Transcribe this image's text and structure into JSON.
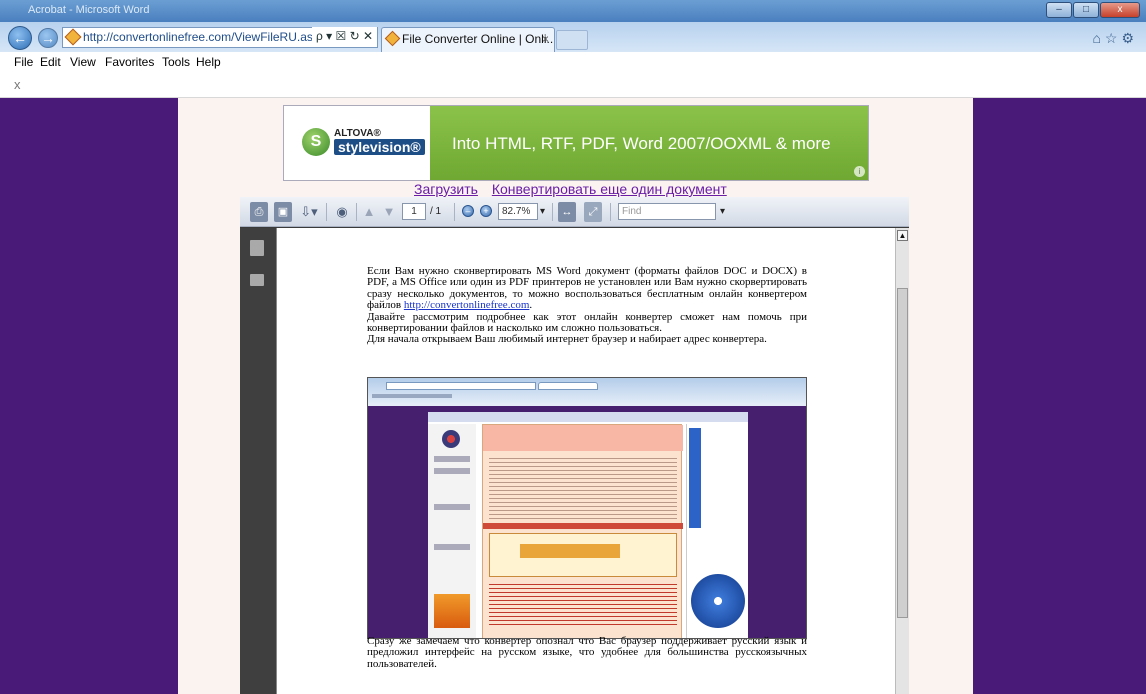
{
  "browser": {
    "window_title": "Acrobat - Microsoft Word",
    "address": "http://convertonlinefree.com/ViewFileRU.aspx?FileN",
    "address_tools": "ρ ▾ ☒ ↻ ✕",
    "tab_title": "File Converter Online | Onli...",
    "tab_close": "×",
    "back": "←",
    "forward": "→",
    "right_icons": "⌂☆⚙",
    "window_buttons": [
      "–",
      "□",
      "x"
    ],
    "menu": [
      "File",
      "Edit",
      "View",
      "Favorites",
      "Tools",
      "Help"
    ],
    "close_bar": "x"
  },
  "banner": {
    "brand": "ALTOVA®",
    "product": "stylevision®",
    "tagline": "Into HTML, RTF, PDF, Word 2007/OOXML & more",
    "info": "i"
  },
  "links": {
    "upload": "Загрузить",
    "convert_another": "Конвертировать еще один документ"
  },
  "viewer": {
    "page_current": "1",
    "page_total": "/ 1",
    "zoom": "82.7%",
    "find_placeholder": "Find"
  },
  "document": {
    "p1": "Если Вам нужно сконвертировать MS Word документ (форматы файлов DOC и DOCX) в PDF, а MS Office или один из PDF принтеров не установлен или Вам нужно скорвертировать сразу несколько документов, то можно воспользоваться бесплатным онлайн конвертером файлов",
    "link": "http://convertonlinefree.com",
    "p1_end": ".",
    "p2": "Давайте рассмотрим подробнее как этот онлайн конвертер сможет нам помочь при конвертировании файлов и насколько им сложно пользоваться.",
    "p3": "Для начала открываем Ваш любимый интернет браузер и набирает адрес конвертера.",
    "p4": "Сразу же замечаем что конвертер опознал что Вас браузер поддерживает русский язык и предложил интерфейс на русском языке, что удобнее для большинства русскоязычных пользователей."
  }
}
